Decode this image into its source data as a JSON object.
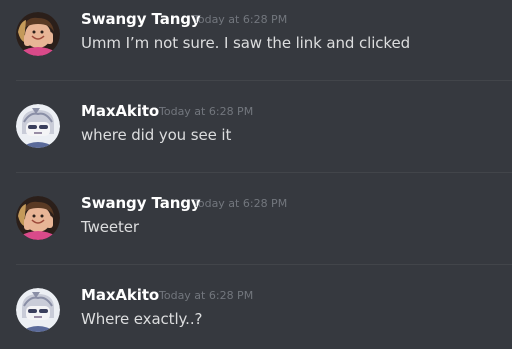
{
  "messages": [
    {
      "author": "Swangy Tangy",
      "timestamp": "Today at 6:28 PM",
      "text": "Umm I’m not sure. I saw the link and clicked",
      "avatar_icon": "swangy-avatar",
      "author_color": "#ffffff"
    },
    {
      "author": "MaxAkito",
      "timestamp": "Today at 6:28 PM",
      "text": "where did you see it",
      "avatar_icon": "maxakito-avatar",
      "author_color": "#ffffff"
    },
    {
      "author": "Swangy Tangy",
      "timestamp": "Today at 6:28 PM",
      "text": "Tweeter",
      "avatar_icon": "swangy-avatar",
      "author_color": "#ffffff"
    },
    {
      "author": "MaxAkito",
      "timestamp": "Today at 6:28 PM",
      "text": "Where exactly..?",
      "avatar_icon": "maxakito-avatar",
      "author_color": "#ffffff"
    }
  ],
  "theme": {
    "background": "#36393f",
    "text": "#dcddde",
    "muted": "#72767d",
    "divider": "#42454a"
  }
}
